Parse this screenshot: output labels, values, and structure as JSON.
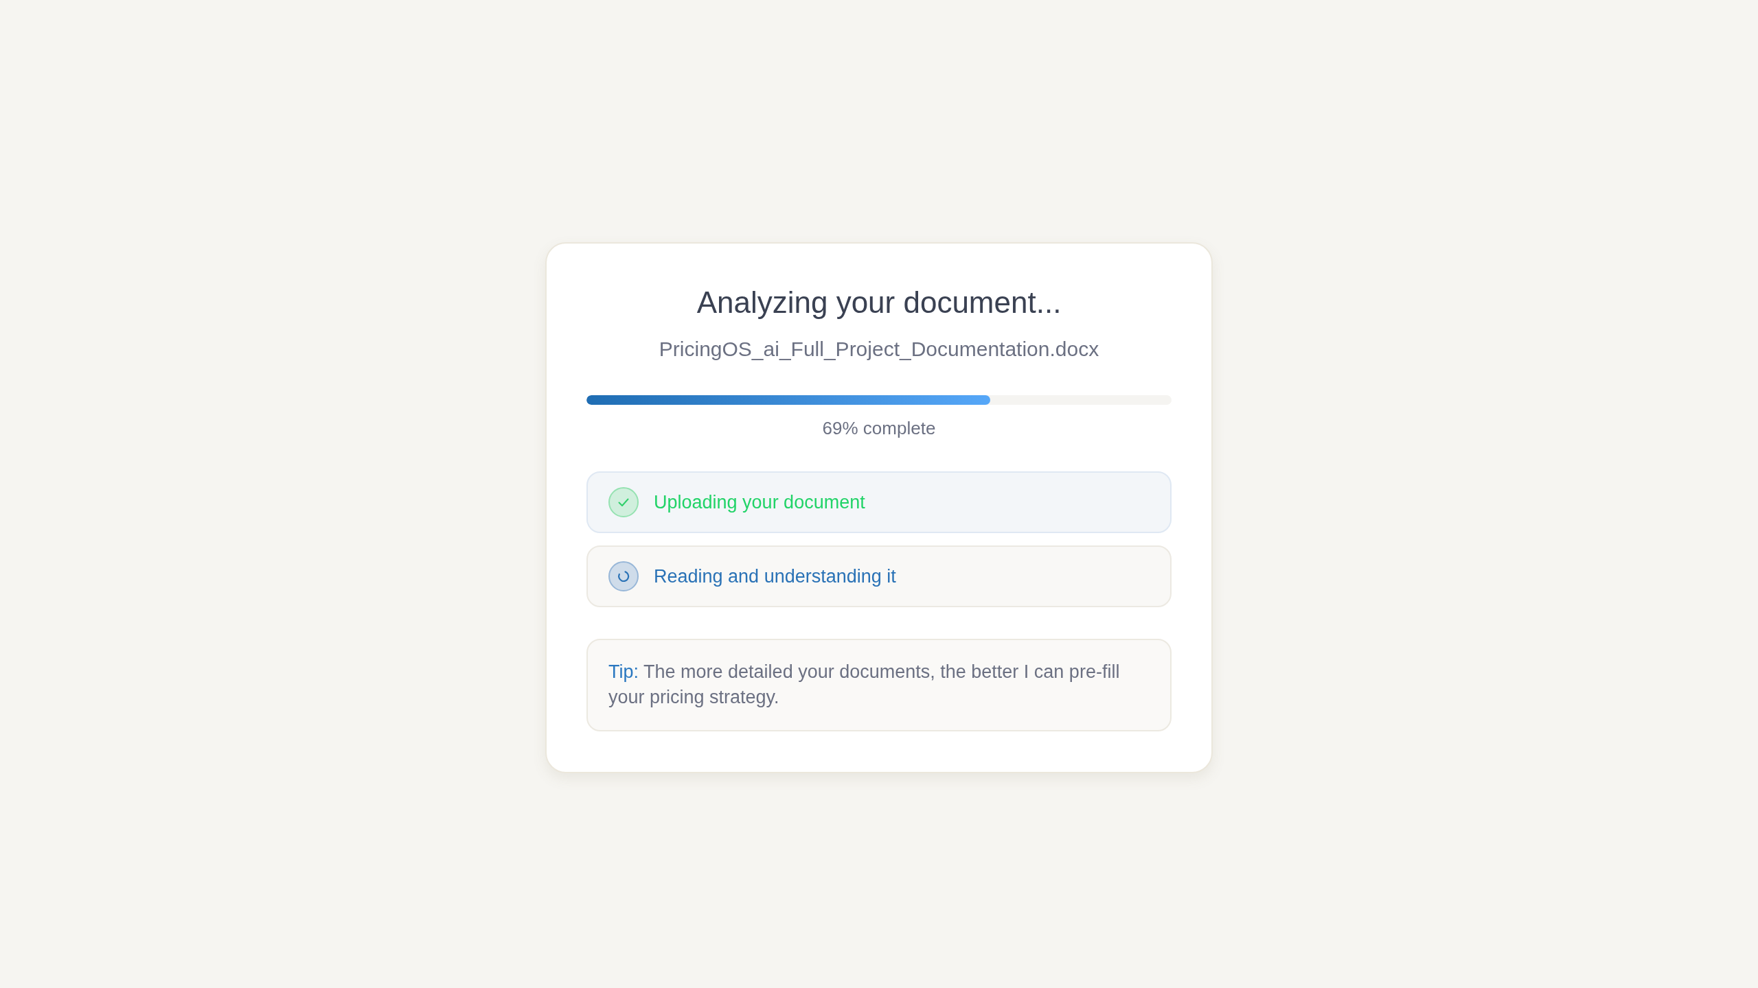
{
  "title": "Analyzing your document...",
  "file_name": "PricingOS_ai_Full_Project_Documentation.docx",
  "progress": {
    "level": 0.69,
    "reading": "69% complete"
  },
  "steps": [
    {
      "label": "Uploading your document",
      "kind": "done"
    },
    {
      "label": "Reading and understanding it",
      "kind": "active"
    }
  ],
  "tip": {
    "label": "Tip:",
    "text": "The more detailed your documents, the better I can pre-fill your pricing strategy."
  }
}
